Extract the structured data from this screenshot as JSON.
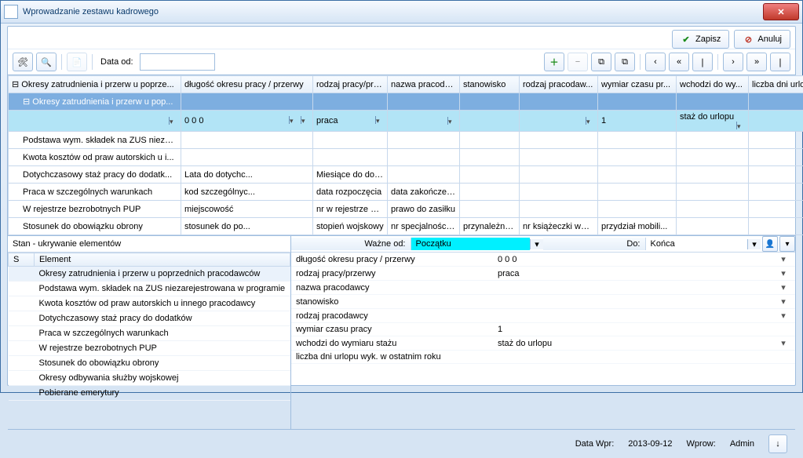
{
  "window": {
    "title": "Wprowadzanie zestawu kadrowego"
  },
  "buttons": {
    "save": "Zapisz",
    "cancel": "Anuluj"
  },
  "toolbar": {
    "dateLabel": "Data od:"
  },
  "grid": {
    "treeHeader": "Okresy zatrudnienia i przerw u poprze...",
    "cols": [
      "długość okresu pracy / przerwy",
      "rodzaj pracy/prz...",
      "nazwa pracoda...",
      "stanowisko",
      "rodzaj pracodaw...",
      "wymiar czasu pr...",
      "wchodzi do wy...",
      "liczba dni urlop..."
    ],
    "treeChild": "Okresy zatrudnienia i przerw u pop...",
    "selRow": {
      "c1": "0 0 0",
      "c2": "praca",
      "c3": "",
      "c4": "",
      "c5": "",
      "c6": "1",
      "c7": "staż do urlopu",
      "c8": ""
    },
    "rows": [
      {
        "tree": "Podstawa wym. składek na ZUS niezar...",
        "c1": "",
        "c2": "",
        "c3": "",
        "c4": "",
        "c5": "",
        "c6": "",
        "c7": "",
        "c8": ""
      },
      {
        "tree": "Kwota kosztów od praw autorskich u i...",
        "c1": "",
        "c2": "",
        "c3": "",
        "c4": "",
        "c5": "",
        "c6": "",
        "c7": "",
        "c8": ""
      },
      {
        "tree": "Dotychczasowy staż pracy do dodatk...",
        "c1": "Lata do dotychc...",
        "c2": "Miesiące do dot...",
        "c3": "",
        "c4": "",
        "c5": "",
        "c6": "",
        "c7": "",
        "c8": ""
      },
      {
        "tree": "Praca w szczególnych warunkach",
        "c1": "kod szczególnyc...",
        "c2": "data rozpoczęcia",
        "c3": "data zakończenia",
        "c4": "",
        "c5": "",
        "c6": "",
        "c7": "",
        "c8": ""
      },
      {
        "tree": "W rejestrze bezrobotnych PUP",
        "c1": "miejscowość",
        "c2": "nr w rejestrze be...",
        "c3": "prawo do zasiłku",
        "c4": "",
        "c5": "",
        "c6": "",
        "c7": "",
        "c8": ""
      },
      {
        "tree": "Stosunek do obowiązku obrony",
        "c1": "stosunek do po...",
        "c2": "stopień wojskowy",
        "c3": "nr specjalności ...",
        "c4": "przynależność d...",
        "c5": "nr książeczki woj...",
        "c6": "przydział mobili...",
        "c7": "",
        "c8": ""
      }
    ]
  },
  "leftPanel": {
    "header": "Stan - ukrywanie elementów",
    "colS": "S",
    "colEl": "Element",
    "items": [
      "Okresy zatrudnienia i przerw u poprzednich pracodawców",
      "Podstawa wym. składek na ZUS niezarejestrowana w programie",
      "Kwota kosztów od praw autorskich u innego pracodawcy",
      "Dotychczasowy staż pracy do dodatków",
      "Praca w szczególnych warunkach",
      "W rejestrze bezrobotnych PUP",
      "Stosunek do obowiązku obrony",
      "Okresy odbywania służby wojskowej",
      "Pobierane emerytury"
    ]
  },
  "filter": {
    "fromLabel": "Ważne od:",
    "fromVal": "Początku",
    "toLabel": "Do:",
    "toVal": "Końca"
  },
  "details": [
    {
      "k": "długość okresu pracy / przerwy",
      "v": "0 0 0",
      "dd": true
    },
    {
      "k": "rodzaj pracy/przerwy",
      "v": "praca",
      "dd": true
    },
    {
      "k": "nazwa pracodawcy",
      "v": "",
      "dd": true
    },
    {
      "k": "stanowisko",
      "v": "",
      "dd": true
    },
    {
      "k": "rodzaj pracodawcy",
      "v": "",
      "dd": true
    },
    {
      "k": "wymiar czasu pracy",
      "v": "1",
      "dd": false
    },
    {
      "k": "wchodzi do wymiaru stażu",
      "v": "staż do urlopu",
      "dd": true
    },
    {
      "k": "liczba dni urlopu wyk. w ostatnim roku",
      "v": "",
      "dd": false
    }
  ],
  "status": {
    "dateLbl": "Data Wpr:",
    "dateVal": "2013-09-12",
    "userLbl": "Wprow:",
    "userVal": "Admin"
  }
}
